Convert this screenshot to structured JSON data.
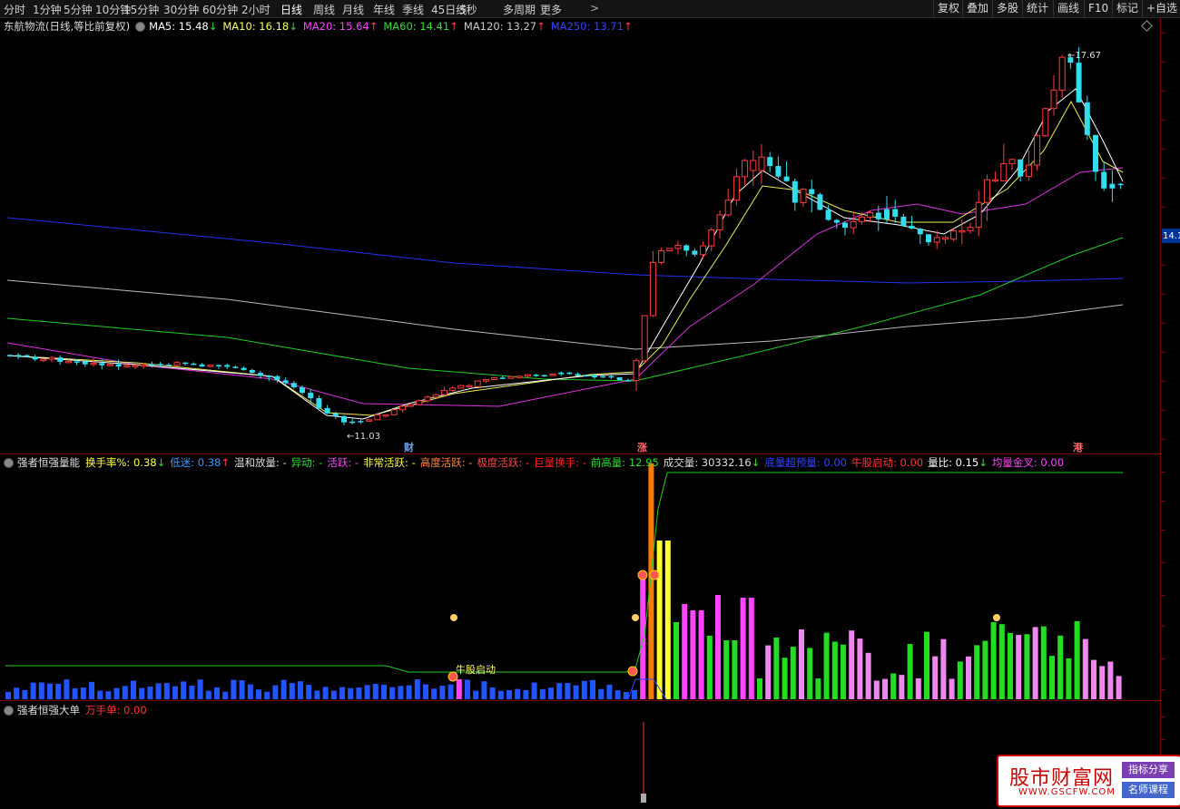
{
  "topbar": {
    "periods": [
      "分时",
      "1分钟",
      "5分钟",
      "10分钟",
      "15分钟",
      "30分钟",
      "60分钟",
      "2小时",
      "日线",
      "周线",
      "月线",
      "年线",
      "季线",
      "45日线",
      "5秒",
      "多周期",
      "更多"
    ],
    "active_period": "日线",
    "more_arrow": ">",
    "right_buttons": [
      "复权",
      "叠加",
      "多股",
      "统计",
      "画线",
      "F10",
      "标记",
      "+自选"
    ]
  },
  "price": {
    "title": "东航物流(日线,等比前复权)",
    "ma": [
      {
        "label": "MA5: 15.48",
        "color": "#ffffff",
        "arrow": "down"
      },
      {
        "label": "MA10: 16.18",
        "color": "#ffff66",
        "arrow": "down"
      },
      {
        "label": "MA20: 15.64",
        "color": "#ff44ff",
        "arrow": "up"
      },
      {
        "label": "MA60: 14.41",
        "color": "#33dd33",
        "arrow": "up"
      },
      {
        "label": "MA120: 13.27",
        "color": "#cccccc",
        "arrow": "up"
      },
      {
        "label": "MA250: 13.71",
        "color": "#3344ff",
        "arrow": "up"
      }
    ],
    "high_label": "17.67",
    "low_label": "11.03",
    "side_label": "14.1",
    "flags": [
      {
        "text": "财",
        "color": "#66aaff"
      },
      {
        "text": "涨",
        "color": "#ff6666"
      },
      {
        "text": "港",
        "color": "#ff6666"
      }
    ]
  },
  "volume": {
    "title": "强者恒强量能",
    "items": [
      {
        "label": "换手率%:",
        "value": "0.38",
        "color": "#ffff44",
        "arrow": "down"
      },
      {
        "label": "低迷:",
        "value": "0.38",
        "color": "#3399ff",
        "arrow": "up"
      },
      {
        "label": "温和放量:",
        "value": "-",
        "color": "#dddddd",
        "arrow": ""
      },
      {
        "label": "异动:",
        "value": "-",
        "color": "#33dd33",
        "arrow": ""
      },
      {
        "label": "活跃:",
        "value": "-",
        "color": "#ff44ff",
        "arrow": ""
      },
      {
        "label": "非常活跃:",
        "value": "-",
        "color": "#ffff44",
        "arrow": ""
      },
      {
        "label": "高度活跃:",
        "value": "-",
        "color": "#ff8844",
        "arrow": ""
      },
      {
        "label": "极度活跃:",
        "value": "-",
        "color": "#ff4444",
        "arrow": ""
      },
      {
        "label": "巨量换手:",
        "value": "-",
        "color": "#ff2222",
        "arrow": ""
      },
      {
        "label": "前高量:",
        "value": "12.95",
        "color": "#33dd33",
        "arrow": ""
      },
      {
        "label": "成交量:",
        "value": "30332.16",
        "color": "#dddddd",
        "arrow": "down"
      },
      {
        "label": "底量超预量:",
        "value": "0.00",
        "color": "#3344ff",
        "arrow": ""
      },
      {
        "label": "牛股启动:",
        "value": "0.00",
        "color": "#ff3333",
        "arrow": ""
      },
      {
        "label": "量比:",
        "value": "0.15",
        "color": "#ffffff",
        "arrow": "down"
      },
      {
        "label": "均量金叉:",
        "value": "0.00",
        "color": "#ff44ff",
        "arrow": ""
      }
    ],
    "start_label": "牛股启动"
  },
  "order": {
    "title": "强者恒强大单",
    "items": [
      {
        "label": "万手单:",
        "value": "0.00",
        "color": "#ff3333"
      }
    ]
  },
  "watermark": {
    "title": "股市财富网",
    "url": "WWW.GSCFW.COM",
    "tag1": "指标分享",
    "tag2": "名师课程"
  }
}
